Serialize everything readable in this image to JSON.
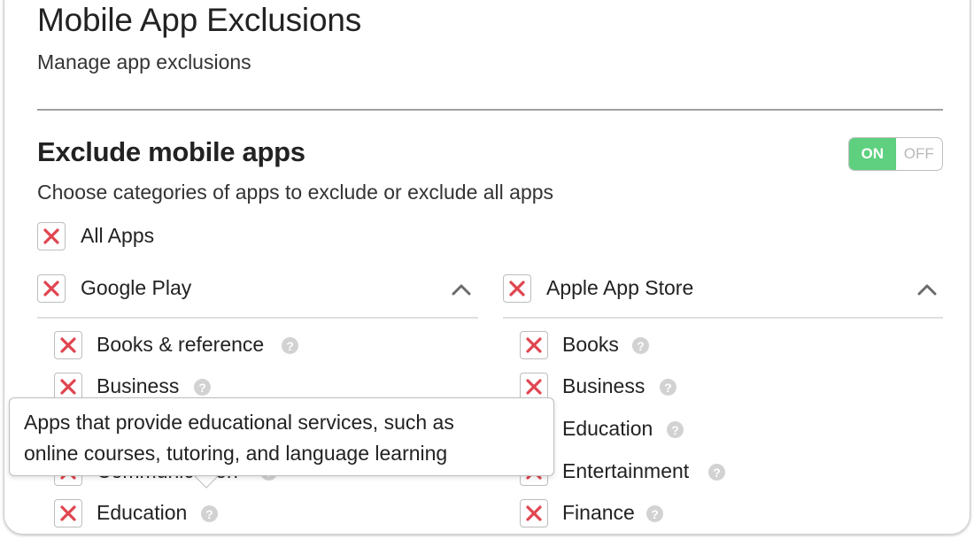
{
  "header": {
    "title": "Mobile App Exclusions",
    "subtitle": "Manage app exclusions"
  },
  "section": {
    "title": "Exclude mobile apps",
    "description": "Choose categories of apps to exclude or exclude all apps",
    "toggle": {
      "on_label": "ON",
      "off_label": "OFF",
      "state": "ON"
    }
  },
  "all_apps": {
    "label": "All Apps",
    "checked": "excluded"
  },
  "google_play": {
    "label": "Google Play",
    "items": [
      {
        "label": "Books & reference"
      },
      {
        "label": "Business"
      },
      {
        "label": "Communication"
      },
      {
        "label": "Education"
      }
    ]
  },
  "apple_store": {
    "label": "Apple App Store",
    "items": [
      {
        "label": "Books"
      },
      {
        "label": "Business"
      },
      {
        "label": "Education"
      },
      {
        "label": "Entertainment"
      },
      {
        "label": "Finance"
      }
    ]
  },
  "tooltip": {
    "line1": "Apps that provide educational services, such as",
    "line2": "online courses, tutoring, and language learning"
  },
  "colors": {
    "accent_on": "#5ed07f",
    "exclude_mark": "#e0454f",
    "help_icon": "#d2d2d2"
  }
}
